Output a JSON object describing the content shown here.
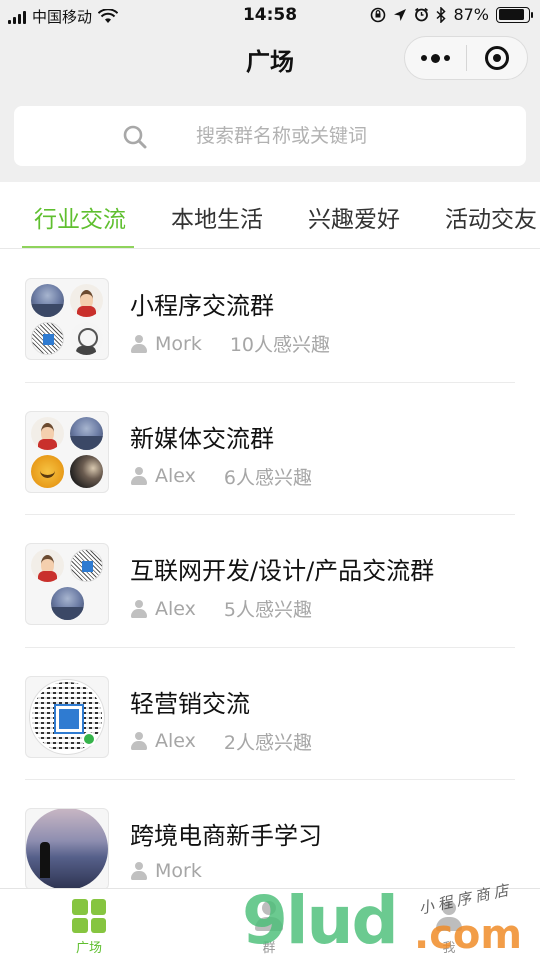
{
  "status_bar": {
    "carrier": "中国移动",
    "time": "14:58",
    "battery_percent": "87%",
    "battery_level": 0.87,
    "icons": [
      "signal-icon",
      "wifi-icon",
      "rotation-lock-icon",
      "location-icon",
      "alarm-icon",
      "bluetooth-icon",
      "battery-icon"
    ]
  },
  "nav": {
    "title": "广场",
    "capsule_icons": [
      "more-dots-icon",
      "close-target-icon"
    ]
  },
  "search": {
    "placeholder": "搜索群名称或关键词",
    "value": ""
  },
  "tabs": [
    {
      "label": "行业交流",
      "active": true
    },
    {
      "label": "本地生活",
      "active": false
    },
    {
      "label": "兴趣爱好",
      "active": false
    },
    {
      "label": "活动交友",
      "active": false
    }
  ],
  "groups": [
    {
      "name": "小程序交流群",
      "owner": "Mork",
      "interest": "10人感兴趣"
    },
    {
      "name": "新媒体交流群",
      "owner": "Alex",
      "interest": "6人感兴趣"
    },
    {
      "name": "互联网开发/设计/产品交流群",
      "owner": "Alex",
      "interest": "5人感兴趣"
    },
    {
      "name": "轻营销交流",
      "owner": "Alex",
      "interest": "2人感兴趣"
    },
    {
      "name": "跨境电商新手学习",
      "owner": "Mork",
      "interest": ""
    }
  ],
  "tabbar": {
    "items": [
      {
        "label": "广场",
        "icon": "grid-icon",
        "active": true,
        "color": "#5fbf2f"
      },
      {
        "label": "群",
        "icon": "group-icon",
        "active": false
      },
      {
        "label": "我",
        "icon": "user-icon",
        "active": false
      }
    ]
  },
  "watermark": {
    "main": "9lud",
    "suffix": ".com",
    "sub": "小程序商店"
  },
  "colors": {
    "accent": "#5fbf2f",
    "underline": "#8fd35c",
    "background_gray": "#efefef"
  }
}
